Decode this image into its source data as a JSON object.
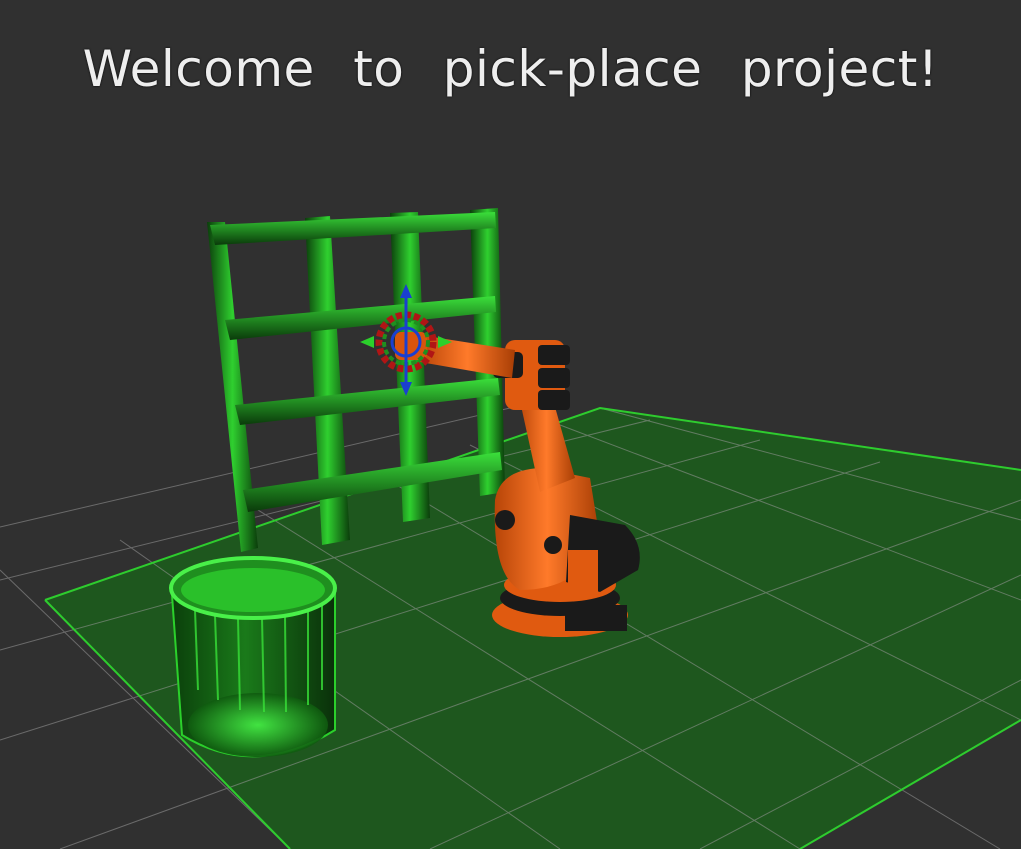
{
  "viewport": {
    "welcome_text": "Welcome to pick-place project!"
  },
  "scene": {
    "objects": [
      "grid-plane",
      "bookshelf",
      "dropbox-bin",
      "kuka-robot-arm",
      "interactive-marker"
    ],
    "colors": {
      "background": "#303030",
      "grid": "#a0a0a0",
      "floor": "#1d5a1d",
      "shelf": "#1fa01f",
      "bin": "#23b023",
      "robot": "#e05a10",
      "robot_dark": "#1a1a1a"
    }
  }
}
